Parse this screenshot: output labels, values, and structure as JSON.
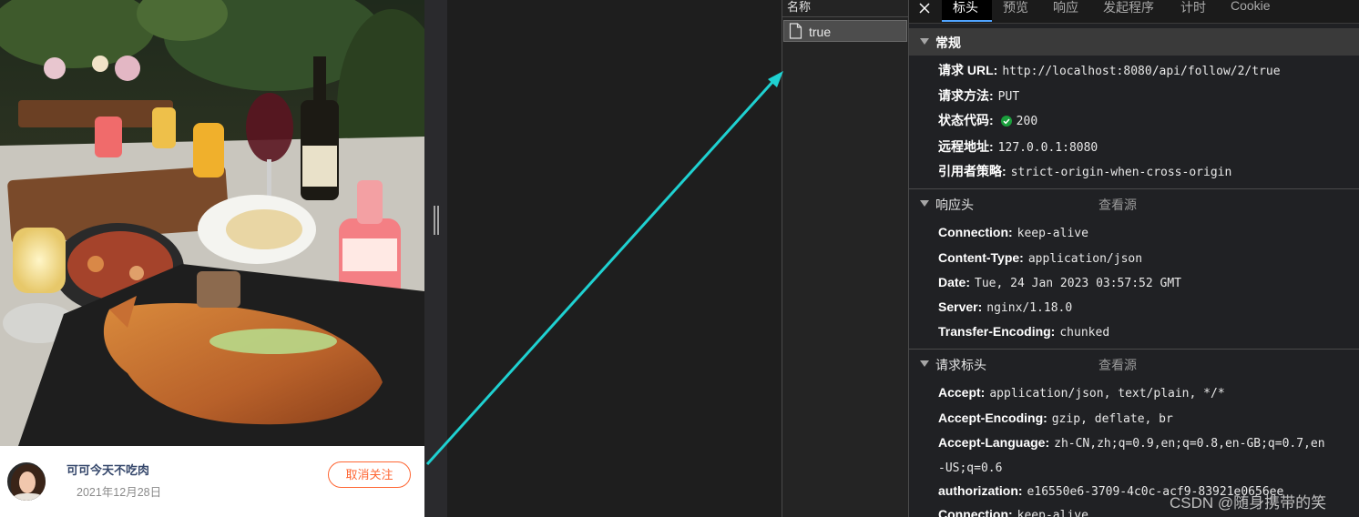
{
  "feed_card": {
    "author": "可可今天不吃肉",
    "date": "2021年12月28日",
    "unfollow_label": "取消关注"
  },
  "network": {
    "name_column_header": "名称",
    "request_name": "true"
  },
  "tabs": [
    "标头",
    "预览",
    "响应",
    "发起程序",
    "计时",
    "Cookie"
  ],
  "general": {
    "title": "常规",
    "rows": [
      {
        "key": "请求 URL:",
        "value": "http://localhost:8080/api/follow/2/true"
      },
      {
        "key": "请求方法:",
        "value": "PUT"
      },
      {
        "key": "状态代码:",
        "value": "200"
      },
      {
        "key": "远程地址:",
        "value": "127.0.0.1:8080"
      },
      {
        "key": "引用者策略:",
        "value": "strict-origin-when-cross-origin"
      }
    ]
  },
  "response_headers": {
    "title": "响应头",
    "view_source": "查看源",
    "rows": [
      {
        "key": "Connection:",
        "value": "keep-alive"
      },
      {
        "key": "Content-Type:",
        "value": "application/json"
      },
      {
        "key": "Date:",
        "value": "Tue, 24 Jan 2023 03:57:52 GMT"
      },
      {
        "key": "Server:",
        "value": "nginx/1.18.0"
      },
      {
        "key": "Transfer-Encoding:",
        "value": "chunked"
      }
    ]
  },
  "request_headers": {
    "title": "请求标头",
    "view_source": "查看源",
    "rows": [
      {
        "key": "Accept:",
        "value": "application/json, text/plain, */*"
      },
      {
        "key": "Accept-Encoding:",
        "value": "gzip, deflate, br"
      },
      {
        "key": "Accept-Language:",
        "value": "zh-CN,zh;q=0.9,en;q=0.8,en-GB;q=0.7,en",
        "continuation": "-US;q=0.6"
      },
      {
        "key": "authorization:",
        "value": "e16550e6-3709-4c0c-acf9-83921e0656ee"
      },
      {
        "key": "Connection:",
        "value": "keep-alive"
      }
    ]
  },
  "watermark": "CSDN @随身携带的笑",
  "colors": {
    "accent_orange": "#ff6633",
    "arrow_cyan": "#1fd1d1",
    "status_green": "#1a9f3c",
    "active_tab_underline": "#4fa3ff"
  }
}
